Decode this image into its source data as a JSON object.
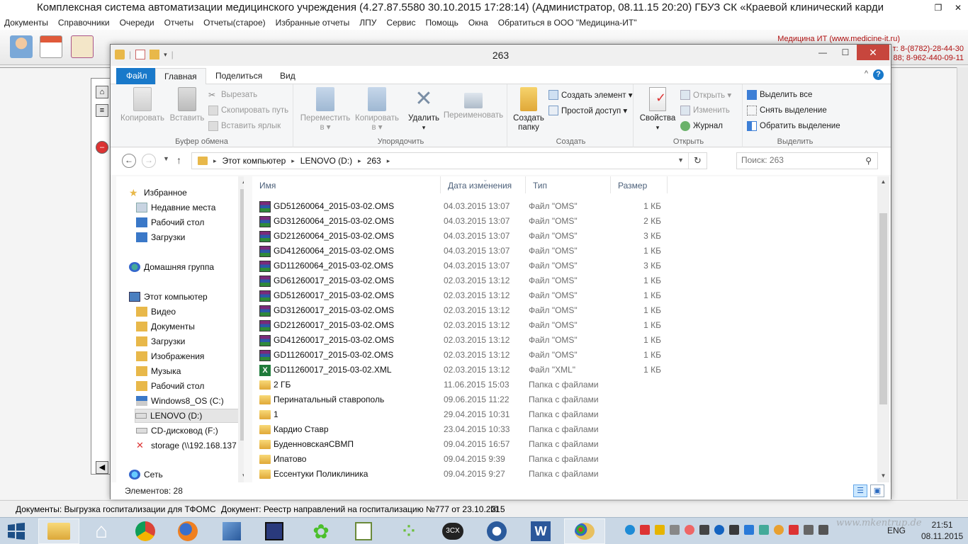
{
  "app": {
    "title": "Комплексная система автоматизации медицинского учреждения (4.27.87.5580 30.10.2015 17:28:14) (Администратор, 08.11.15 20:20) ГБУЗ СК «Краевой клинический карди",
    "menu": [
      "Документы",
      "Справочники",
      "Очереди",
      "Отчеты",
      "Отчеты(старое)",
      "Избранные отчеты",
      "ЛПУ",
      "Сервис",
      "Помощь",
      "Окна",
      "Обратиться в ООО \"Медицина-ИТ\""
    ],
    "brand": "Медицина ИТ (www.medicine-it.ru)",
    "phone1": "т: 8-(8782)-28-44-30",
    "phone2": "88; 8-962-440-09-11",
    "status_doc1": "Документы: Выгрузка госпитализации для ТФОМС",
    "status_doc2": "Документ: Реестр направлений на госпитализацию №777 от 23.10.2015",
    "status_close": "☒"
  },
  "explorer": {
    "title": "263",
    "tabs": {
      "file": "Файл",
      "home": "Главная",
      "share": "Поделиться",
      "view": "Вид"
    },
    "ribbon": {
      "clipboard": {
        "label": "Буфер обмена",
        "copy": "Копировать",
        "paste": "Вставить",
        "cut": "Вырезать",
        "copy_path": "Скопировать путь",
        "paste_shortcut": "Вставить ярлык"
      },
      "organize": {
        "label": "Упорядочить",
        "move": "Переместить",
        "move2": "в ▾",
        "copy_to": "Копировать",
        "copy2": "в ▾",
        "delete": "Удалить",
        "rename": "Переименовать"
      },
      "create": {
        "label": "Создать",
        "new_folder": "Создать",
        "new_folder2": "папку",
        "new_item": "Создать элемент ▾",
        "easy_access": "Простой доступ ▾"
      },
      "open": {
        "label": "Открыть",
        "properties": "Свойства",
        "open": "Открыть ▾",
        "edit": "Изменить",
        "history": "Журнал"
      },
      "select": {
        "label": "Выделить",
        "select_all": "Выделить все",
        "select_none": "Снять выделение",
        "invert": "Обратить выделение"
      }
    },
    "address": {
      "crumbs": [
        "Этот компьютер",
        "LENOVO (D:)",
        "263"
      ]
    },
    "search_placeholder": "Поиск: 263",
    "nav": {
      "favorites": "Избранное",
      "recent": "Недавние места",
      "desktop": "Рабочий стол",
      "downloads": "Загрузки",
      "homegroup": "Домашняя группа",
      "this_pc": "Этот компьютер",
      "video": "Видео",
      "documents": "Документы",
      "downloads2": "Загрузки",
      "images": "Изображения",
      "music": "Музыка",
      "desktop2": "Рабочий стол",
      "drive_c": "Windows8_OS (C:)",
      "drive_d": "LENOVO (D:)",
      "drive_f": "CD-дисковод (F:)",
      "storage": "storage (\\\\192.168.137",
      "network": "Сеть"
    },
    "columns": {
      "name": "Имя",
      "date": "Дата изменения",
      "type": "Тип",
      "size": "Размер"
    },
    "files": [
      {
        "name": "GD51260064_2015-03-02.OMS",
        "date": "04.03.2015 13:07",
        "type": "Файл \"OMS\"",
        "size": "1 КБ",
        "kind": "archive"
      },
      {
        "name": "GD31260064_2015-03-02.OMS",
        "date": "04.03.2015 13:07",
        "type": "Файл \"OMS\"",
        "size": "2 КБ",
        "kind": "archive"
      },
      {
        "name": "GD21260064_2015-03-02.OMS",
        "date": "04.03.2015 13:07",
        "type": "Файл \"OMS\"",
        "size": "3 КБ",
        "kind": "archive"
      },
      {
        "name": "GD41260064_2015-03-02.OMS",
        "date": "04.03.2015 13:07",
        "type": "Файл \"OMS\"",
        "size": "1 КБ",
        "kind": "archive"
      },
      {
        "name": "GD11260064_2015-03-02.OMS",
        "date": "04.03.2015 13:07",
        "type": "Файл \"OMS\"",
        "size": "3 КБ",
        "kind": "archive"
      },
      {
        "name": "GD61260017_2015-03-02.OMS",
        "date": "02.03.2015 13:12",
        "type": "Файл \"OMS\"",
        "size": "1 КБ",
        "kind": "archive"
      },
      {
        "name": "GD51260017_2015-03-02.OMS",
        "date": "02.03.2015 13:12",
        "type": "Файл \"OMS\"",
        "size": "1 КБ",
        "kind": "archive"
      },
      {
        "name": "GD31260017_2015-03-02.OMS",
        "date": "02.03.2015 13:12",
        "type": "Файл \"OMS\"",
        "size": "1 КБ",
        "kind": "archive"
      },
      {
        "name": "GD21260017_2015-03-02.OMS",
        "date": "02.03.2015 13:12",
        "type": "Файл \"OMS\"",
        "size": "1 КБ",
        "kind": "archive"
      },
      {
        "name": "GD41260017_2015-03-02.OMS",
        "date": "02.03.2015 13:12",
        "type": "Файл \"OMS\"",
        "size": "1 КБ",
        "kind": "archive"
      },
      {
        "name": "GD11260017_2015-03-02.OMS",
        "date": "02.03.2015 13:12",
        "type": "Файл \"OMS\"",
        "size": "1 КБ",
        "kind": "archive"
      },
      {
        "name": "GD11260017_2015-03-02.XML",
        "date": "02.03.2015 13:12",
        "type": "Файл \"XML\"",
        "size": "1 КБ",
        "kind": "xml"
      },
      {
        "name": "2 ГБ",
        "date": "11.06.2015 15:03",
        "type": "Папка с файлами",
        "size": "",
        "kind": "folder"
      },
      {
        "name": "Перинатальный ставрополь",
        "date": "09.06.2015 11:22",
        "type": "Папка с файлами",
        "size": "",
        "kind": "folder"
      },
      {
        "name": "1",
        "date": "29.04.2015 10:31",
        "type": "Папка с файлами",
        "size": "",
        "kind": "folder"
      },
      {
        "name": "Кардио Ставр",
        "date": "23.04.2015 10:33",
        "type": "Папка с файлами",
        "size": "",
        "kind": "folder"
      },
      {
        "name": "БуденновскаяСВМП",
        "date": "09.04.2015 16:57",
        "type": "Папка с файлами",
        "size": "",
        "kind": "folder"
      },
      {
        "name": "Ипатово",
        "date": "09.04.2015 9:39",
        "type": "Папка с файлами",
        "size": "",
        "kind": "folder"
      },
      {
        "name": "Ессентуки Поликлиника",
        "date": "09.04.2015 9:27",
        "type": "Папка с файлами",
        "size": "",
        "kind": "folder"
      }
    ],
    "status_count": "Элементов: 28"
  },
  "taskbar": {
    "lang": "ENG",
    "time": "21:51",
    "date": "08.11.2015",
    "watermark": "www.mkentrup.de"
  },
  "colors": {
    "accent": "#1979ca",
    "close": "#c7463d",
    "folder": "#e8b84a",
    "taskbar": "#c9d7e5"
  }
}
